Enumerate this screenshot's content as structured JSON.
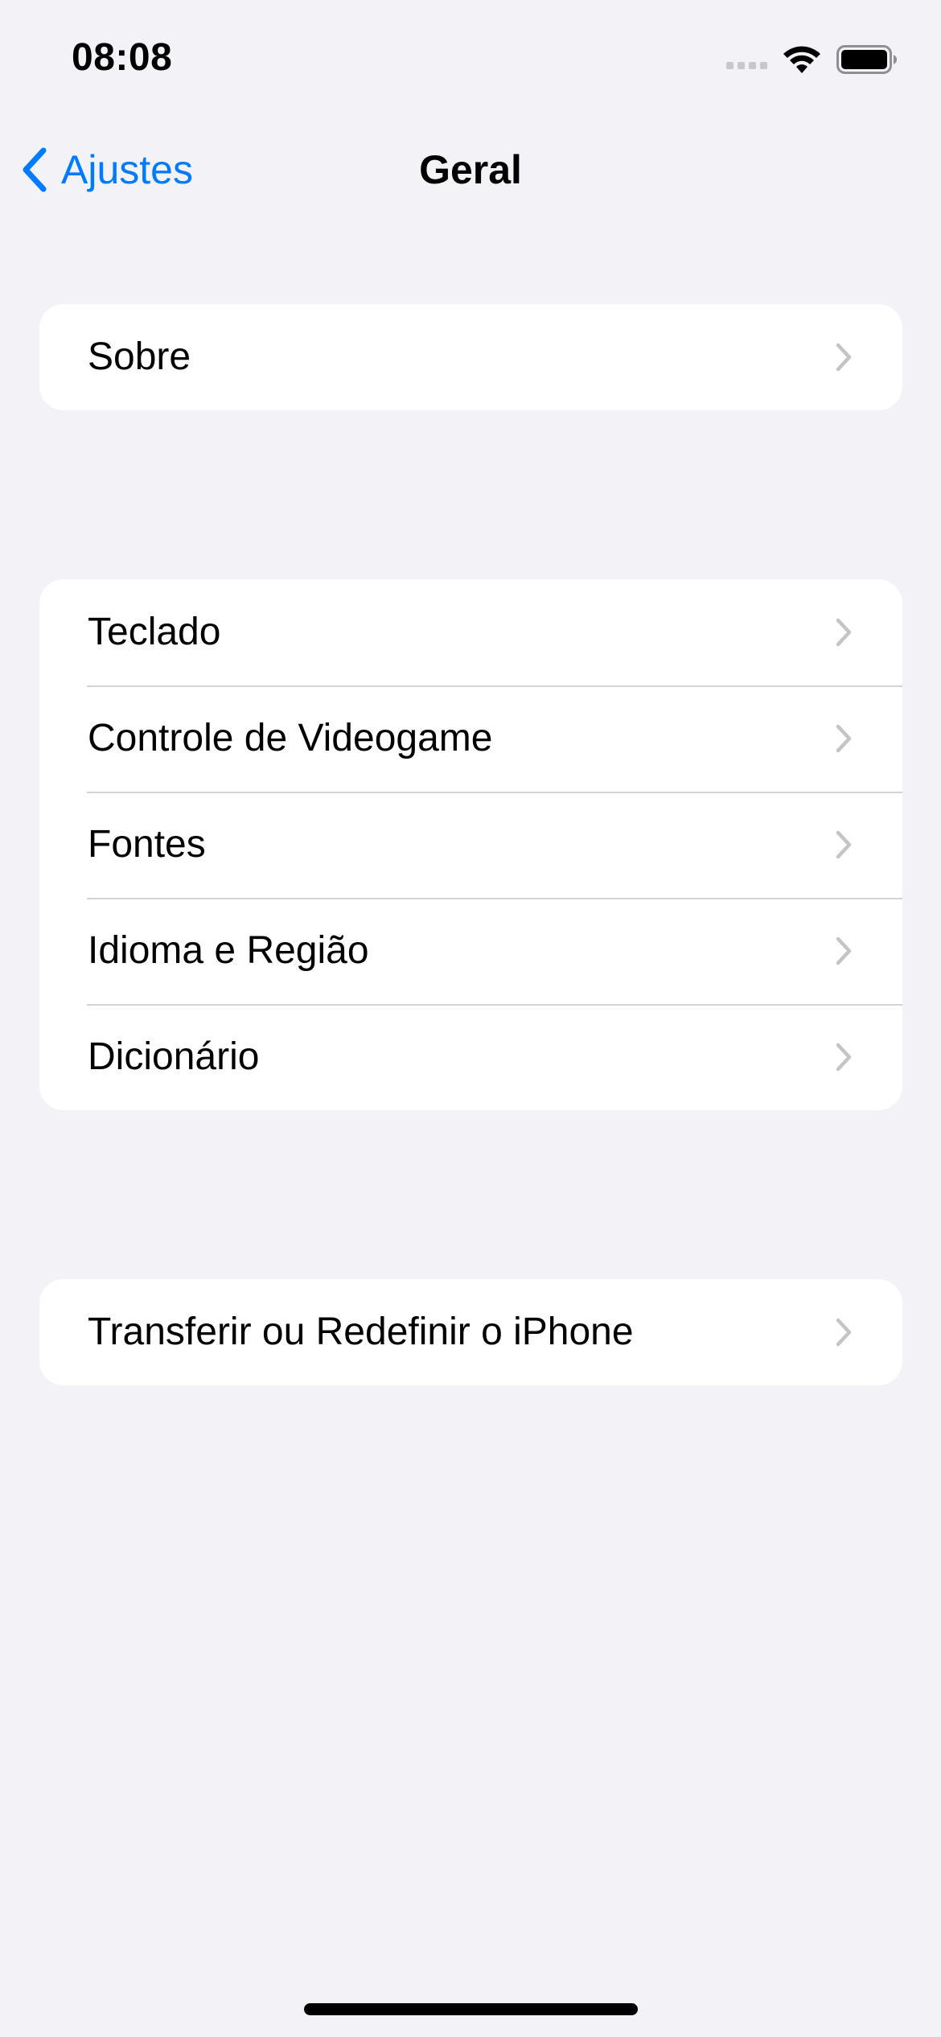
{
  "status_bar": {
    "time": "08:08",
    "icons": [
      "cellular-signal-icon",
      "wifi-icon",
      "battery-icon"
    ]
  },
  "nav": {
    "back_label": "Ajustes",
    "title": "Geral"
  },
  "groups": [
    {
      "items": [
        {
          "label": "Sobre"
        }
      ]
    },
    {
      "items": [
        {
          "label": "Teclado"
        },
        {
          "label": "Controle de Videogame"
        },
        {
          "label": "Fontes"
        },
        {
          "label": "Idioma e Região"
        },
        {
          "label": "Dicionário"
        }
      ]
    },
    {
      "items": [
        {
          "label": "Transferir ou Redefinir o iPhone"
        }
      ]
    }
  ],
  "colors": {
    "background": "#f2f2f7",
    "accent": "#007aff",
    "cell": "#ffffff",
    "separator": "#d1d1d6",
    "chevron": "#c4c4c7"
  }
}
